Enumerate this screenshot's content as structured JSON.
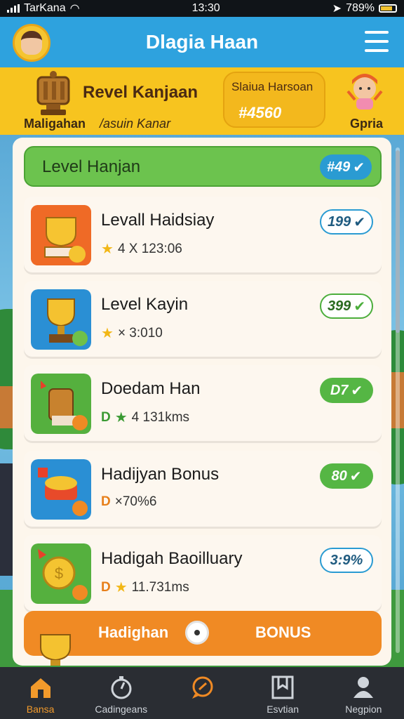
{
  "status_bar": {
    "carrier": "TarKana",
    "time": "13:30",
    "battery": "789%"
  },
  "header": {
    "title": "Dlagia Haan"
  },
  "banner": {
    "title": "Revel Kanjaan",
    "sub_left": "Maligahan",
    "sub_right": "/asuin Kanar",
    "card_title": "Slaiua Harsoan",
    "card_value": "#4560",
    "mascot_label": "Gpria"
  },
  "list": {
    "header_title": "Level Hanjan",
    "header_badge": "#49",
    "items": [
      {
        "title": "Levall Haidsiay",
        "meta": "4 X 123:06",
        "badge": "199",
        "prefix": "star"
      },
      {
        "title": "Level Kayin",
        "meta": "× 3:010",
        "badge": "399",
        "prefix": "star"
      },
      {
        "title": "Doedam Han",
        "meta": "4 131kms",
        "badge": "D7",
        "prefix": "D-star"
      },
      {
        "title": "Hadijyan Bonus",
        "meta": "×70%6",
        "badge": "80",
        "prefix": "D"
      },
      {
        "title": "Hadigah Baoilluary",
        "meta": "11.731ms",
        "badge": "3:9%",
        "prefix": "D-star"
      }
    ],
    "bonus_left": "Hadighan",
    "bonus_right": "BONUS"
  },
  "nav": {
    "items": [
      {
        "label": "Bansa",
        "icon": "home-icon"
      },
      {
        "label": "Cadingeans",
        "icon": "timer-icon"
      },
      {
        "label": "",
        "icon": "chat-icon"
      },
      {
        "label": "Esvtian",
        "icon": "bookmark-icon"
      },
      {
        "label": "Negpion",
        "icon": "profile-icon"
      }
    ]
  },
  "colors": {
    "header_blue": "#2ea2de",
    "banner_yellow": "#f7c41f",
    "accent_green": "#6cc34e",
    "accent_orange": "#f08a24"
  }
}
